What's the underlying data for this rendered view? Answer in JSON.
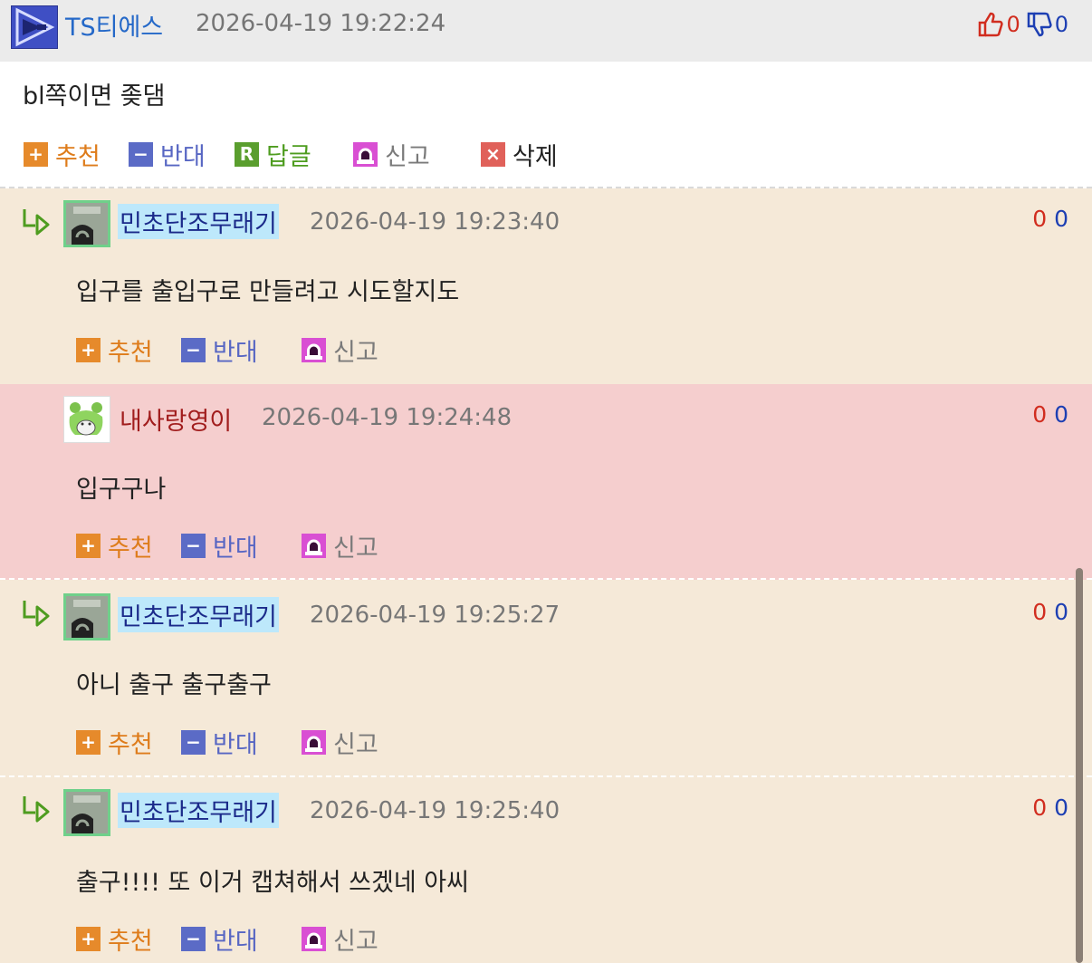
{
  "main_comment": {
    "author": "TS티에스",
    "time": "2026-04-19 19:22:24",
    "up_votes": "0",
    "down_votes": "0",
    "text": "bl쪽이면 좆댐",
    "actions": {
      "recommend": "추천",
      "oppose": "반대",
      "reply": "답글",
      "report": "신고",
      "delete": "삭제"
    }
  },
  "replies": [
    {
      "author": "민초단조무래기",
      "time": "2026-04-19 19:23:40",
      "up_votes": "0",
      "down_votes": "0",
      "text": "입구를 출입구로 만들려고 시도할지도",
      "actions": {
        "recommend": "추천",
        "oppose": "반대",
        "report": "신고"
      }
    },
    {
      "author": "내사랑영이",
      "time": "2026-04-19 19:24:48",
      "up_votes": "0",
      "down_votes": "0",
      "text": "입구구나",
      "actions": {
        "recommend": "추천",
        "oppose": "반대",
        "report": "신고"
      }
    },
    {
      "author": "민초단조무래기",
      "time": "2026-04-19 19:25:27",
      "up_votes": "0",
      "down_votes": "0",
      "text": "아니 출구 출구출구",
      "actions": {
        "recommend": "추천",
        "oppose": "반대",
        "report": "신고"
      }
    },
    {
      "author": "민초단조무래기",
      "time": "2026-04-19 19:25:40",
      "up_votes": "0",
      "down_votes": "0",
      "text": "출구!!!! 또 이거 캡쳐해서 쓰겠네 아씨",
      "actions": {
        "recommend": "추천",
        "oppose": "반대",
        "report": "신고"
      }
    }
  ],
  "icons": {
    "main_avatar": "play-logo-icon",
    "thumb_up": "thumbs-up-icon",
    "thumb_down": "thumbs-down-icon",
    "reply_arrow": "reply-arrow-icon",
    "recommend": "plus-icon",
    "oppose": "minus-icon",
    "reply": "reply-r-icon",
    "report": "siren-icon",
    "delete": "close-icon"
  },
  "colors": {
    "reply_bg": "#f5e9d8",
    "highlight_bg": "#f5cece",
    "header_bg": "#ebebeb",
    "author_link": "#2468c8",
    "up_vote": "#d12d1f",
    "down_vote": "#1d3fb3"
  }
}
